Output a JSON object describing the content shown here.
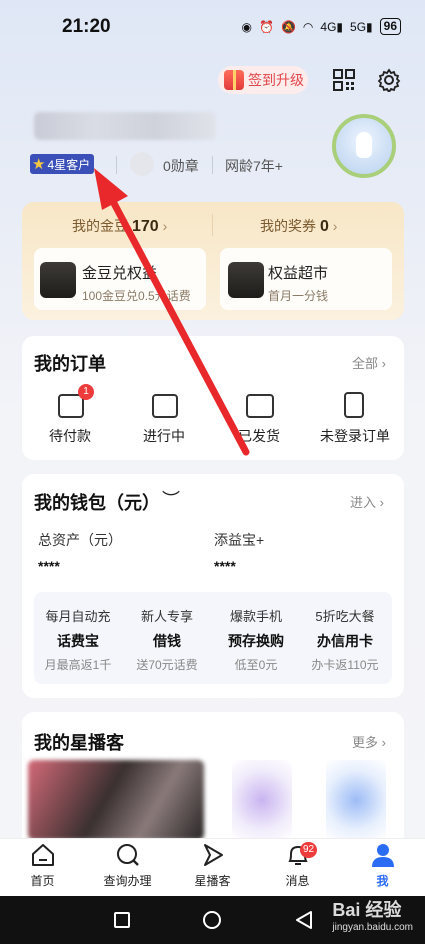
{
  "status_bar": {
    "time": "21:20",
    "battery": "96"
  },
  "header": {
    "signin_label": "签到升级"
  },
  "profile": {
    "star_level": "4星客户",
    "medals": "0勋章",
    "network_age": "网龄7年+"
  },
  "gold": {
    "beans_label": "我的金豆",
    "beans_value": "170",
    "coupons_label": "我的奖券",
    "coupons_value": "0",
    "exchange_title": "金豆兑权益",
    "exchange_desc": "100金豆兑0.5元话费",
    "market_title": "权益超市",
    "market_desc": "首月一分钱"
  },
  "orders": {
    "title": "我的订单",
    "all_label": "全部",
    "items": [
      {
        "label": "待付款",
        "badge": "1"
      },
      {
        "label": "进行中"
      },
      {
        "label": "已发货"
      },
      {
        "label": "未登录订单"
      }
    ]
  },
  "wallet": {
    "title": "我的钱包（元）",
    "enter_label": "进入",
    "total_label": "总资产（元）",
    "total_value": "****",
    "tianyi_label": "添益宝+",
    "tianyi_value": "****",
    "promos": [
      {
        "top": "每月自动充",
        "main": "话费宝",
        "bottom": "月最高返1千"
      },
      {
        "top": "新人专享",
        "main": "借钱",
        "bottom": "送70元话费"
      },
      {
        "top": "爆款手机",
        "main": "预存换购",
        "bottom": "低至0元"
      },
      {
        "top": "5折吃大餐",
        "main": "办信用卡",
        "bottom": "办卡返110元"
      }
    ]
  },
  "xingbo": {
    "title": "我的星播客",
    "more_label": "更多"
  },
  "tabs": [
    {
      "label": "首页",
      "icon": "home-icon"
    },
    {
      "label": "查询办理",
      "icon": "search-icon"
    },
    {
      "label": "星播客",
      "icon": "play-icon"
    },
    {
      "label": "消息",
      "icon": "bell-icon",
      "badge": "92"
    },
    {
      "label": "我",
      "icon": "user-icon",
      "active": true
    }
  ],
  "watermark": {
    "main": "Bai 经验",
    "sub": "jingyan.baidu.com"
  },
  "colors": {
    "accent": "#2b6cf5",
    "badge": "#ee3b3b",
    "arrow": "#e8282b",
    "star_badge": "#3a4fb8"
  }
}
